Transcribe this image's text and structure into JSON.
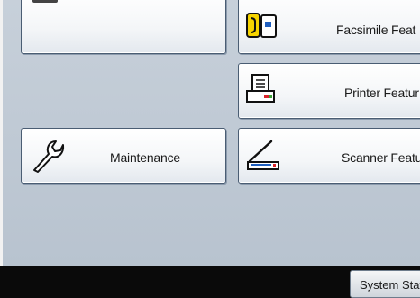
{
  "buttons": {
    "facsimile": {
      "label": "Facsimile Feat",
      "icon": "facsimile-icon"
    },
    "printer": {
      "label": "Printer Featur",
      "icon": "printer-icon"
    },
    "maintenance": {
      "label": "Maintenance",
      "icon": "wrench-icon"
    },
    "scanner": {
      "label": "Scanner Featu",
      "icon": "scanner-icon"
    }
  },
  "footer": {
    "system_status_label": "System Statu"
  },
  "colors": {
    "background": "#c0cad5",
    "button_border": "#4a5d73",
    "footer": "#0a0a0a",
    "accent_red": "#d9242b",
    "accent_blue": "#1f5fbf"
  }
}
